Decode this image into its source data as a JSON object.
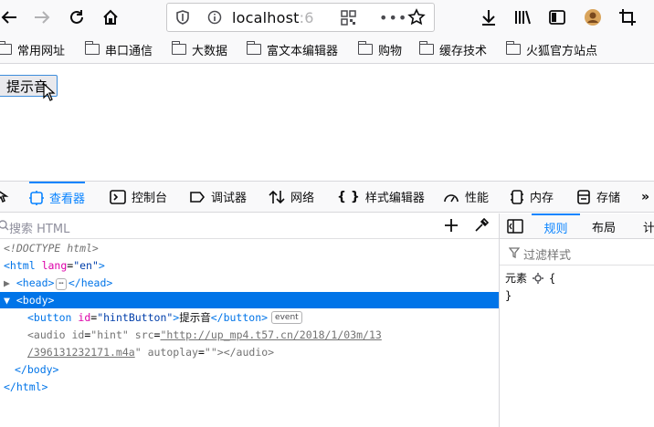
{
  "toolbar": {
    "url_host": "localhost",
    "url_rest": ":6"
  },
  "bookmarks": [
    {
      "label": "常用网址"
    },
    {
      "label": "串口通信"
    },
    {
      "label": "大数据"
    },
    {
      "label": "富文本编辑器"
    },
    {
      "label": "购物"
    },
    {
      "label": "缓存技术"
    },
    {
      "label": "火狐官方站点"
    }
  ],
  "page": {
    "hint_button_label": "提示音"
  },
  "devtools": {
    "tabs": [
      {
        "label": "查看器",
        "icon": "inspector-icon"
      },
      {
        "label": "控制台",
        "icon": "console-icon"
      },
      {
        "label": "调试器",
        "icon": "debugger-icon"
      },
      {
        "label": "网络",
        "icon": "network-icon"
      },
      {
        "label": "样式编辑器",
        "icon": "style-editor-icon"
      },
      {
        "label": "性能",
        "icon": "performance-icon"
      },
      {
        "label": "内存",
        "icon": "memory-icon"
      },
      {
        "label": "存储",
        "icon": "storage-icon"
      }
    ],
    "search_placeholder": "搜索 HTML",
    "markup": {
      "doctype": "<!DOCTYPE html>",
      "html_open_tag": "<html",
      "html_attr": "lang",
      "html_val": "\"en\"",
      "head_tag": "<head>",
      "head_ell": "⋯",
      "head_close": "</head>",
      "body_open": "<body>",
      "button_open": "<button",
      "button_attr": "id",
      "button_val": "\"hintButton\"",
      "button_text": "提示音",
      "button_close": "</button>",
      "event_badge": "event",
      "audio_open": "<audio",
      "audio_id_attr": "id",
      "audio_id_val": "\"hint\"",
      "audio_src_attr": "src",
      "audio_src_val_1": "\"http://up_mp4.t57.cn/2018/1/03m/13",
      "audio_src_val_2": "/396131232171.m4a",
      "audio_src_val_2_q": "\"",
      "audio_autoplay_attr": "autoplay",
      "audio_autoplay_val": "\"\"",
      "audio_close": "</audio>",
      "body_close": "</body>",
      "html_close": "</html>"
    },
    "side_tabs": [
      {
        "label": "规则"
      },
      {
        "label": "布局"
      },
      {
        "label": "计"
      }
    ],
    "filter_placeholder": "过滤样式",
    "rule_selector": "元素",
    "rule_open": "{",
    "rule_close": "}"
  }
}
